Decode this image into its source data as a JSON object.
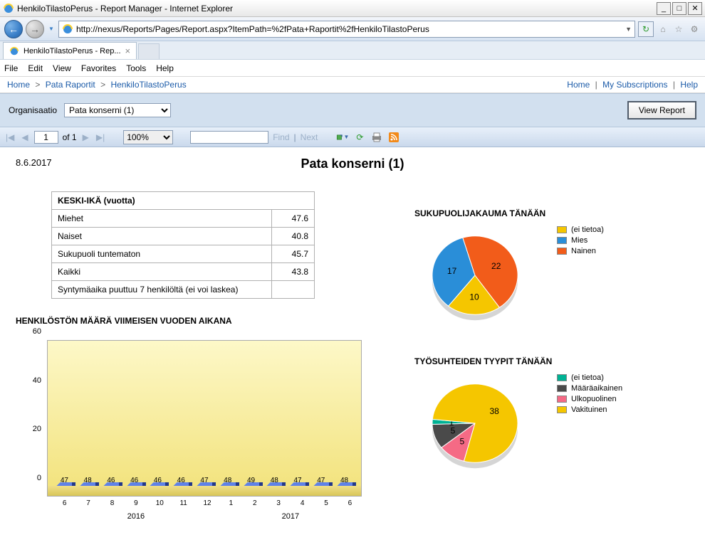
{
  "window": {
    "title": "HenkiloTilastoPerus - Report Manager - Internet Explorer",
    "url": "http://nexus/Reports/Pages/Report.aspx?ItemPath=%2fPata+Raportit%2fHenkiloTilastoPerus"
  },
  "tab": {
    "label": "HenkiloTilastoPerus - Rep..."
  },
  "menubar": {
    "file": "File",
    "edit": "Edit",
    "view": "View",
    "favorites": "Favorites",
    "tools": "Tools",
    "help": "Help"
  },
  "breadcrumb": {
    "home": "Home",
    "pata": "Pata Raportit",
    "current": "HenkiloTilastoPerus",
    "right_home": "Home",
    "subs": "My Subscriptions",
    "help": "Help"
  },
  "params": {
    "label": "Organisaatio",
    "value": "Pata konserni (1)",
    "view_btn": "View Report"
  },
  "toolbar": {
    "page": "1",
    "of": "of 1",
    "zoom": "100%",
    "find_text": "",
    "find": "Find",
    "next": "Next"
  },
  "report": {
    "date": "8.6.2017",
    "title": "Pata konserni (1)",
    "avg_age": {
      "header": "KESKI-IKÄ (vuotta)",
      "rows": [
        {
          "label": "Miehet",
          "value": "47.6"
        },
        {
          "label": "Naiset",
          "value": "40.8"
        },
        {
          "label": "Sukupuoli tuntematon",
          "value": "45.7"
        },
        {
          "label": "Kaikki",
          "value": "43.8"
        },
        {
          "label": "Syntymäaika puuttuu 7 henkilöltä (ei voi laskea)",
          "value": ""
        }
      ]
    },
    "staff_count": {
      "title": "HENKILÖSTÖN MÄÄRÄ  VIIMEISEN VUODEN AIKANA",
      "year1": "2016",
      "year2": "2017"
    },
    "gender_pie": {
      "title": "SUKUPUOLIJAKAUMA TÄNÄÄN",
      "legend": [
        {
          "label": "(ei tietoa)",
          "color": "#f5c600"
        },
        {
          "label": "Mies",
          "color": "#2a8ed8"
        },
        {
          "label": "Nainen",
          "color": "#f25c1a"
        }
      ]
    },
    "contract_pie": {
      "title": "TYÖSUHTEIDEN TYYPIT TÄNÄÄN",
      "legend": [
        {
          "label": "(ei tietoa)",
          "color": "#00b294"
        },
        {
          "label": "Määräaikainen",
          "color": "#4a4a4a"
        },
        {
          "label": "Ulkopuolinen",
          "color": "#f56a85"
        },
        {
          "label": "Vakituinen",
          "color": "#f5c600"
        }
      ]
    }
  },
  "chart_data": [
    {
      "id": "staff_bar",
      "type": "bar",
      "title": "HENKILÖSTÖN MÄÄRÄ VIIMEISEN VUODEN AIKANA",
      "categories": [
        "6",
        "7",
        "8",
        "9",
        "10",
        "11",
        "12",
        "1",
        "2",
        "3",
        "4",
        "5",
        "6"
      ],
      "category_years": [
        "2016",
        "2016",
        "2016",
        "2016",
        "2016",
        "2016",
        "2016",
        "2017",
        "2017",
        "2017",
        "2017",
        "2017",
        "2017"
      ],
      "values": [
        47,
        48,
        46,
        46,
        46,
        46,
        47,
        48,
        49,
        48,
        47,
        47,
        48
      ],
      "ylim": [
        0,
        60
      ],
      "yticks": [
        0,
        20,
        40,
        60
      ]
    },
    {
      "id": "gender_pie",
      "type": "pie",
      "title": "SUKUPUOLIJAKAUMA TÄNÄÄN",
      "series": [
        {
          "name": "(ei tietoa)",
          "value": 10,
          "color": "#f5c600"
        },
        {
          "name": "Mies",
          "value": 17,
          "color": "#2a8ed8"
        },
        {
          "name": "Nainen",
          "value": 22,
          "color": "#f25c1a"
        }
      ]
    },
    {
      "id": "contract_pie",
      "type": "pie",
      "title": "TYÖSUHTEIDEN TYYPIT TÄNÄÄN",
      "series": [
        {
          "name": "(ei tietoa)",
          "value": 1,
          "color": "#00b294"
        },
        {
          "name": "Määräaikainen",
          "value": 5,
          "color": "#4a4a4a"
        },
        {
          "name": "Ulkopuolinen",
          "value": 5,
          "color": "#f56a85"
        },
        {
          "name": "Vakituinen",
          "value": 38,
          "color": "#f5c600"
        }
      ]
    }
  ]
}
